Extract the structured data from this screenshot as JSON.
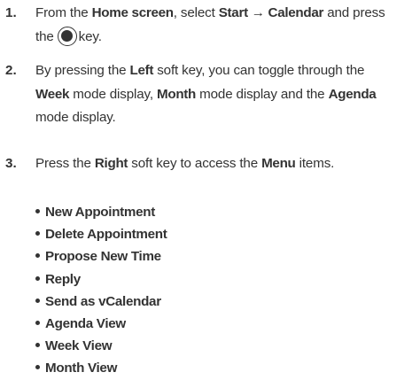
{
  "steps": [
    {
      "number": "1.",
      "line1": {
        "t1": "From the ",
        "b1": "Home screen",
        "t2": ", select ",
        "b2": "Start → Calendar",
        "t3": " and press"
      },
      "line2": {
        "t1": "the",
        "icon": "center-select-key-icon",
        "t2": "key."
      }
    },
    {
      "number": "2.",
      "t1": "By pressing the ",
      "b1": "Left",
      "t2": " soft key, you can toggle through the ",
      "b2": "Week",
      "t3": " mode display, ",
      "b3": "Month",
      "t4": " mode display and the ",
      "b4": "Agenda",
      "t5": " mode display."
    },
    {
      "number": "3.",
      "t1": "Press the ",
      "b1": "Right",
      "t2": " soft key to access the ",
      "b2": "Menu",
      "t3": " items."
    }
  ],
  "menu_items": [
    "New Appointment",
    "Delete Appointment",
    "Propose New Time",
    "Reply",
    "Send as vCalendar",
    "Agenda View",
    "Week View",
    "Month View"
  ]
}
